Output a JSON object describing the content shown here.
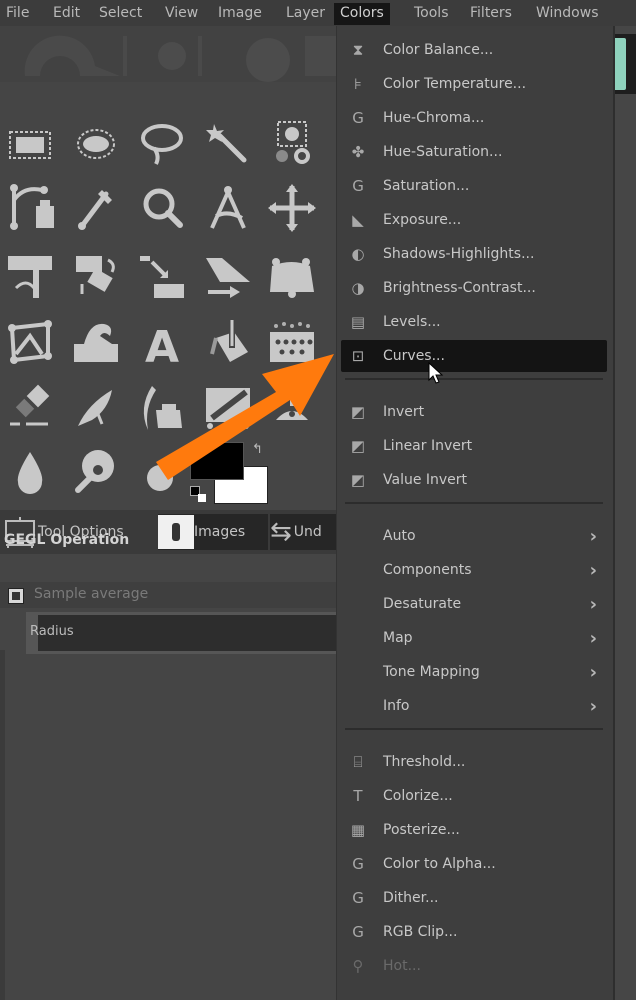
{
  "menubar": {
    "items": [
      {
        "label": "File"
      },
      {
        "label": "Edit"
      },
      {
        "label": "Select"
      },
      {
        "label": "View"
      },
      {
        "label": "Image"
      },
      {
        "label": "Layer"
      },
      {
        "label": "Colors",
        "active": true
      },
      {
        "label": "Tools"
      },
      {
        "label": "Filters"
      },
      {
        "label": "Windows"
      }
    ]
  },
  "toolbox": {
    "tools": [
      {
        "name": "rectangle-select-icon"
      },
      {
        "name": "ellipse-select-icon"
      },
      {
        "name": "free-select-icon"
      },
      {
        "name": "fuzzy-select-icon"
      },
      {
        "name": "foreground-select-icon"
      },
      {
        "name": "paths-icon"
      },
      {
        "name": "color-picker-icon"
      },
      {
        "name": "zoom-icon"
      },
      {
        "name": "measure-icon"
      },
      {
        "name": "move-icon"
      },
      {
        "name": "crop-icon"
      },
      {
        "name": "unified-transform-icon"
      },
      {
        "name": "align-icon"
      },
      {
        "name": "shear-icon"
      },
      {
        "name": "warp-transform-icon"
      },
      {
        "name": "cage-transform-icon"
      },
      {
        "name": "warp-icon"
      },
      {
        "name": "text-icon"
      },
      {
        "name": "bucket-fill-icon"
      },
      {
        "name": "gradient-icon"
      },
      {
        "name": "eraser-icon"
      },
      {
        "name": "airbrush-icon"
      },
      {
        "name": "ink-icon"
      },
      {
        "name": "mypaint-brush-icon"
      },
      {
        "name": "clone-icon"
      },
      {
        "name": "blur-icon"
      },
      {
        "name": "smudge-icon"
      },
      {
        "name": "dodge-burn-icon"
      }
    ],
    "foreground_color": "#000000",
    "background_color": "#ffffff"
  },
  "dock": {
    "tabs": [
      {
        "label": "Tool Options"
      },
      {
        "label": "Images"
      },
      {
        "label": "Und"
      }
    ],
    "section_title": "GEGL Operation",
    "sample_average_label": "Sample average",
    "radius_label": "Radius"
  },
  "colors_menu": {
    "groups": [
      [
        {
          "label": "Color Balance...",
          "icon": "color-balance-icon",
          "glyph": "⧗"
        },
        {
          "label": "Color Temperature...",
          "icon": "color-temperature-icon",
          "glyph": "⊧"
        },
        {
          "label": "Hue-Chroma...",
          "icon": "gegl-icon",
          "glyph": "G"
        },
        {
          "label": "Hue-Saturation...",
          "icon": "hue-saturation-icon",
          "glyph": "✤"
        },
        {
          "label": "Saturation...",
          "icon": "gegl-icon",
          "glyph": "G"
        },
        {
          "label": "Exposure...",
          "icon": "exposure-icon",
          "glyph": "◣"
        },
        {
          "label": "Shadows-Highlights...",
          "icon": "shadows-highlights-icon",
          "glyph": "◐"
        },
        {
          "label": "Brightness-Contrast...",
          "icon": "brightness-contrast-icon",
          "glyph": "◑"
        },
        {
          "label": "Levels...",
          "icon": "levels-icon",
          "glyph": "▤"
        },
        {
          "label": "Curves...",
          "icon": "curves-icon",
          "glyph": "⊡",
          "highlighted": true
        }
      ],
      [
        {
          "label": "Invert",
          "icon": "invert-icon",
          "glyph": "◩"
        },
        {
          "label": "Linear Invert",
          "icon": "linear-invert-icon",
          "glyph": "◩"
        },
        {
          "label": "Value Invert",
          "icon": "value-invert-icon",
          "glyph": "◩"
        }
      ],
      [
        {
          "label": "Auto",
          "submenu": true
        },
        {
          "label": "Components",
          "submenu": true
        },
        {
          "label": "Desaturate",
          "submenu": true
        },
        {
          "label": "Map",
          "submenu": true
        },
        {
          "label": "Tone Mapping",
          "submenu": true
        },
        {
          "label": "Info",
          "submenu": true
        }
      ],
      [
        {
          "label": "Threshold...",
          "icon": "threshold-icon",
          "glyph": "⌸"
        },
        {
          "label": "Colorize...",
          "icon": "colorize-icon",
          "glyph": "T"
        },
        {
          "label": "Posterize...",
          "icon": "posterize-icon",
          "glyph": "▦"
        },
        {
          "label": "Color to Alpha...",
          "icon": "gegl-icon",
          "glyph": "G"
        },
        {
          "label": "Dither...",
          "icon": "gegl-icon",
          "glyph": "G"
        },
        {
          "label": "RGB Clip...",
          "icon": "gegl-icon",
          "glyph": "G"
        },
        {
          "label": "Hot...",
          "icon": "hot-icon",
          "glyph": "⚲",
          "disabled": true
        }
      ]
    ],
    "submenu_arrow": "›"
  },
  "annotation": {
    "arrow_color": "#ff7a0d",
    "points_to": "Curves..."
  }
}
